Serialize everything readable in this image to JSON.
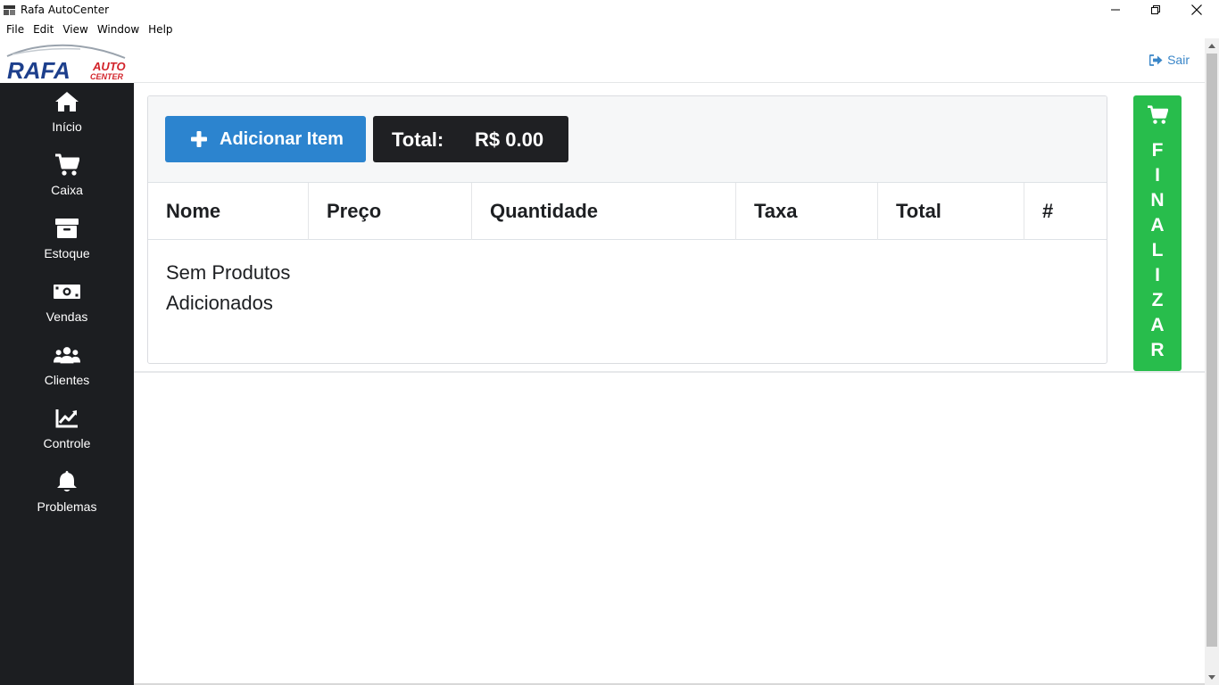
{
  "window": {
    "title": "Rafa AutoCenter",
    "controls": [
      "minimize",
      "maximize",
      "close"
    ]
  },
  "menu": [
    "File",
    "Edit",
    "View",
    "Window",
    "Help"
  ],
  "logo": {
    "primary": "RAFA",
    "secondary_1": "AUTO",
    "secondary_2": "CENTER"
  },
  "sidebar": {
    "items": [
      {
        "label": "Início",
        "icon": "home-icon"
      },
      {
        "label": "Caixa",
        "icon": "cart-icon"
      },
      {
        "label": "Estoque",
        "icon": "archive-icon"
      },
      {
        "label": "Vendas",
        "icon": "money-bill-icon"
      },
      {
        "label": "Clientes",
        "icon": "users-icon"
      },
      {
        "label": "Controle",
        "icon": "chart-line-icon"
      },
      {
        "label": "Problemas",
        "icon": "bell-icon"
      }
    ]
  },
  "header": {
    "logout_label": "Sair"
  },
  "toolbar": {
    "add_label": "Adicionar Item",
    "total_label": "Total:",
    "total_value": "R$ 0.00"
  },
  "table": {
    "columns": [
      "Nome",
      "Preço",
      "Quantidade",
      "Taxa",
      "Total",
      "#"
    ],
    "empty_message": "Sem Produtos Adicionados"
  },
  "finalizar": {
    "letters": [
      "F",
      "I",
      "N",
      "A",
      "L",
      "I",
      "Z",
      "A",
      "R"
    ]
  },
  "colors": {
    "sidebar_bg": "#1c1e21",
    "primary_button": "#2c84cf",
    "total_box": "#1f2023",
    "finalize_button": "#28bd4c",
    "link": "#3a86c8"
  }
}
